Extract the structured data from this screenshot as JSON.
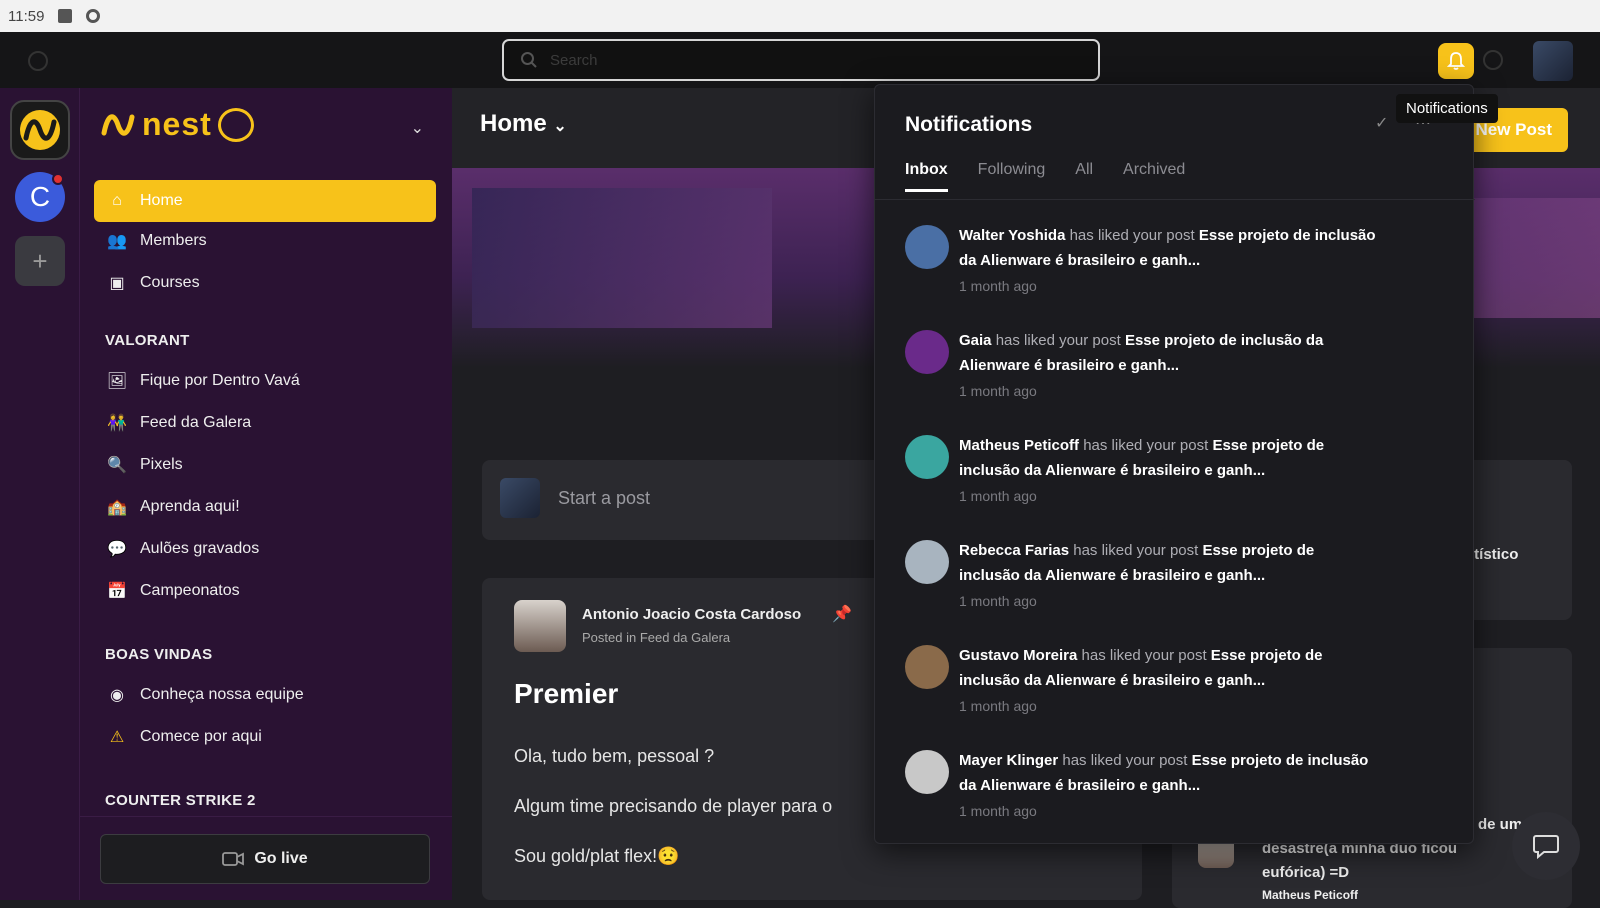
{
  "status_bar": {
    "time": "11:59"
  },
  "search": {
    "placeholder": "Search"
  },
  "tooltip": "Notifications",
  "community": {
    "name": "nest"
  },
  "sidebar": {
    "items": [
      {
        "label": "Home",
        "icon": "home-icon"
      },
      {
        "label": "Members",
        "icon": "users-icon"
      },
      {
        "label": "Courses",
        "icon": "book-icon"
      }
    ],
    "sections": [
      {
        "title": "VALORANT",
        "items": [
          {
            "label": "Fique por Dentro Vavá"
          },
          {
            "label": "Feed da Galera"
          },
          {
            "label": "Pixels"
          },
          {
            "label": "Aprenda aqui!"
          },
          {
            "label": "Aulões gravados"
          },
          {
            "label": "Campeonatos"
          }
        ]
      },
      {
        "title": "BOAS VINDAS",
        "items": [
          {
            "label": "Conheça nossa equipe"
          },
          {
            "label": "Comece por aqui"
          }
        ]
      },
      {
        "title": "COUNTER STRIKE 2"
      }
    ],
    "go_live": "Go live"
  },
  "rail": {
    "community_initial": "C",
    "add": "+"
  },
  "main": {
    "title": "Home",
    "new_post": "New Post",
    "composer_placeholder": "Start a post",
    "post": {
      "author": "Antonio Joacio Costa Cardoso",
      "meta": "Posted in Feed da Galera",
      "title": "Premier",
      "lines": [
        "Ola, tudo bem, pessoal ?",
        "Algum time precisando de player para o",
        "Sou gold/plat flex!😟"
      ]
    },
    "right_card_text": "artístico",
    "right_card2_lines": [
      "de um",
      "desastre(a minha duo ficou",
      "eufórica) =D",
      "Matheus Peticoff"
    ]
  },
  "notifications": {
    "title": "Notifications",
    "tabs": [
      "Inbox",
      "Following",
      "All",
      "Archived"
    ],
    "action_text": "has liked your post",
    "items": [
      {
        "user": "Walter Yoshida",
        "post": "Esse projeto de inclusão da Alienware é brasileiro e ganh...",
        "time": "1 month ago",
        "color": "#4a6fa5"
      },
      {
        "user": "Gaia",
        "post": "Esse projeto de inclusão da Alienware é brasileiro e ganh...",
        "time": "1 month ago",
        "color": "#6a2a8a"
      },
      {
        "user": "Matheus Peticoff",
        "post": "Esse projeto de inclusão da Alienware é brasileiro e ganh...",
        "time": "1 month ago",
        "color": "#3aa6a0"
      },
      {
        "user": "Rebecca Farias",
        "post": "Esse projeto de inclusão da Alienware é brasileiro e ganh...",
        "time": "1 month ago",
        "color": "#a8b4bf"
      },
      {
        "user": "Gustavo Moreira",
        "post": "Esse projeto de inclusão da Alienware é brasileiro e ganh...",
        "time": "1 month ago",
        "color": "#8a6a4a"
      },
      {
        "user": "Mayer Klinger",
        "post": "Esse projeto de inclusão da Alienware é brasileiro e ganh...",
        "time": "1 month ago",
        "color": "#c8c8c8"
      }
    ]
  },
  "colors": {
    "accent": "#f7c21a",
    "sidebar_bg": "#2a1233",
    "badge": "#e03131"
  }
}
